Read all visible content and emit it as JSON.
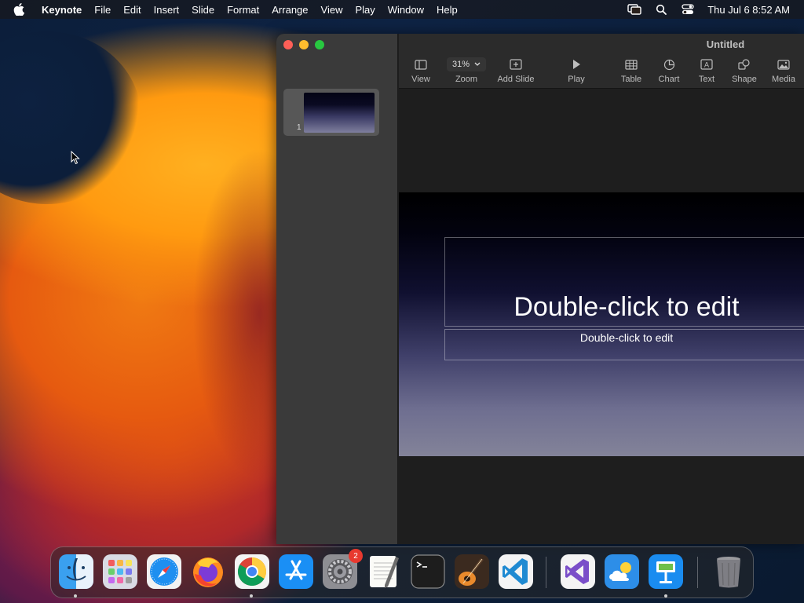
{
  "menubar": {
    "app_name": "Keynote",
    "items": [
      "File",
      "Edit",
      "Insert",
      "Slide",
      "Format",
      "Arrange",
      "View",
      "Play",
      "Window",
      "Help"
    ],
    "clock": "Thu Jul 6  8:52 AM",
    "status_icons": [
      "screen-mirroring-icon",
      "spotlight-search-icon",
      "control-center-icon"
    ]
  },
  "window": {
    "title": "Untitled",
    "toolbar": {
      "view_label": "View",
      "zoom_value": "31%",
      "zoom_label": "Zoom",
      "add_slide_label": "Add Slide",
      "play_label": "Play",
      "table_label": "Table",
      "chart_label": "Chart",
      "text_label": "Text",
      "shape_label": "Shape",
      "media_label": "Media"
    },
    "navigator": {
      "slides": [
        {
          "number": "1"
        }
      ]
    },
    "slide": {
      "title_placeholder": "Double-click to edit",
      "subtitle_placeholder": "Double-click to edit"
    }
  },
  "dock": {
    "apps": [
      {
        "name": "Finder",
        "icon": "finder-icon",
        "running": true
      },
      {
        "name": "Launchpad",
        "icon": "launchpad-icon",
        "running": false
      },
      {
        "name": "Safari",
        "icon": "safari-icon",
        "running": false
      },
      {
        "name": "Firefox",
        "icon": "firefox-icon",
        "running": false
      },
      {
        "name": "Google Chrome",
        "icon": "chrome-icon",
        "running": true
      },
      {
        "name": "App Store",
        "icon": "app-store-icon",
        "running": false
      },
      {
        "name": "System Settings",
        "icon": "system-settings-icon",
        "running": false,
        "badge": "2"
      },
      {
        "name": "TextEdit",
        "icon": "textedit-icon",
        "running": false
      },
      {
        "name": "Terminal",
        "icon": "terminal-icon",
        "running": false
      },
      {
        "name": "GarageBand",
        "icon": "garageband-icon",
        "running": false
      },
      {
        "name": "Visual Studio Code",
        "icon": "vscode-icon",
        "running": false
      },
      {
        "name": "Visual Studio",
        "icon": "visual-studio-icon",
        "running": false
      },
      {
        "name": "Weather",
        "icon": "weather-icon",
        "running": false
      },
      {
        "name": "Keynote",
        "icon": "keynote-icon",
        "running": true
      },
      {
        "name": "Trash",
        "icon": "trash-icon",
        "running": false
      }
    ]
  },
  "colors": {
    "close": "#fe5f57",
    "minimize": "#febc2e",
    "maximize": "#28c840",
    "badge": "#e8392f"
  }
}
